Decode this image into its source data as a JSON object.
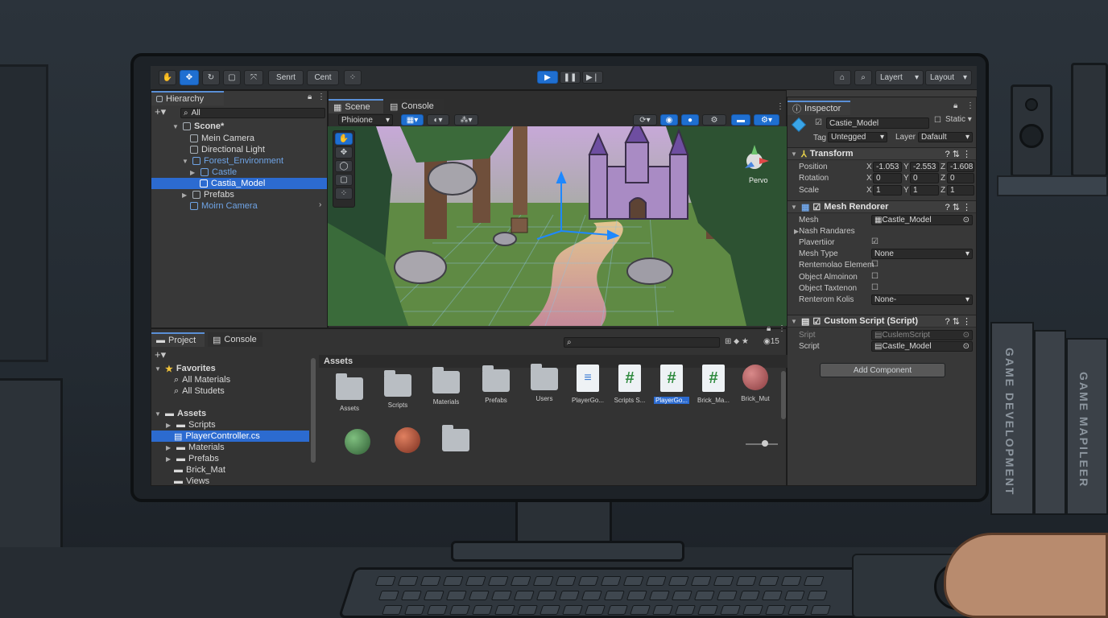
{
  "toolbar": {
    "scene_btn": "Senrt",
    "center_btn": "Cent",
    "layers": "Layert",
    "layout": "Layout"
  },
  "hierarchy": {
    "tab": "Hierarchy",
    "search": "All",
    "items": [
      "Scone*",
      "Mein Camera",
      "Directional Light",
      "Forest_Environment",
      "Castle",
      "Castia_Model",
      "Prefabs",
      "Moirn Camera"
    ]
  },
  "scene_tabs": {
    "scene": "Scene",
    "console": "Console",
    "shading": "Phioione",
    "gizmo_label": "Pervo"
  },
  "inspector": {
    "tab": "Inspector",
    "object_name": "Castie_Model",
    "static": "Static",
    "tag_label": "Tag",
    "tag_value": "Untegged",
    "layer_label": "Layer",
    "layer_value": "Dafault",
    "transform": {
      "title": "Transform",
      "position_label": "Position",
      "rotation_label": "Rotation",
      "scale_label": "Scale",
      "px": "-1.053",
      "py": "-2.553",
      "pz": "-1.608",
      "rx": "0",
      "ry": "0",
      "rz": "0",
      "sx": "1",
      "sy": "1",
      "sz": "1"
    },
    "mesh_renderer": {
      "title": "Mesh Rendorer",
      "mesh_label": "Mesh",
      "mesh_value": "Castle_Model",
      "rows": [
        "Nash Randares",
        "Plavertiior",
        "Mesh Type",
        "Rentemolao Elemem",
        "Object Almoinon",
        "Object Taxtenon",
        "Renterom Kolis"
      ],
      "mesh_type_value": "None",
      "renterom_value": "None-"
    },
    "custom_script": {
      "title": "Custom Script (Script)",
      "script_label": "Sript",
      "script_value": "CuslemScript",
      "script_label2": "Script",
      "script_value2": "Castle_Model"
    },
    "add_component": "Add Component"
  },
  "project": {
    "tab": "Project",
    "console_tab": "Console",
    "count": "15",
    "favorites": "Favorites",
    "fav_items": [
      "All Materials",
      "All Studets"
    ],
    "assets": "Assets",
    "tree": [
      "Scripts",
      "PlayerController.cs",
      "Materials",
      "Prefabs",
      "Brick_Mat",
      "Views"
    ],
    "grid_header": "Assets",
    "grid": [
      "Assets",
      "Scripts",
      "Materials",
      "Prefabs",
      "Users",
      "PlayerGo...",
      "Scripts S...",
      "PlayerGo...",
      "Brick_Ma...",
      "Brick_Mut"
    ]
  },
  "books": [
    "GAME DEVELOPMENT",
    "GAME MAPILEER"
  ],
  "colors": {
    "accent": "#2c6bd0",
    "panel": "#383838",
    "toolbar": "#2a2d30"
  }
}
